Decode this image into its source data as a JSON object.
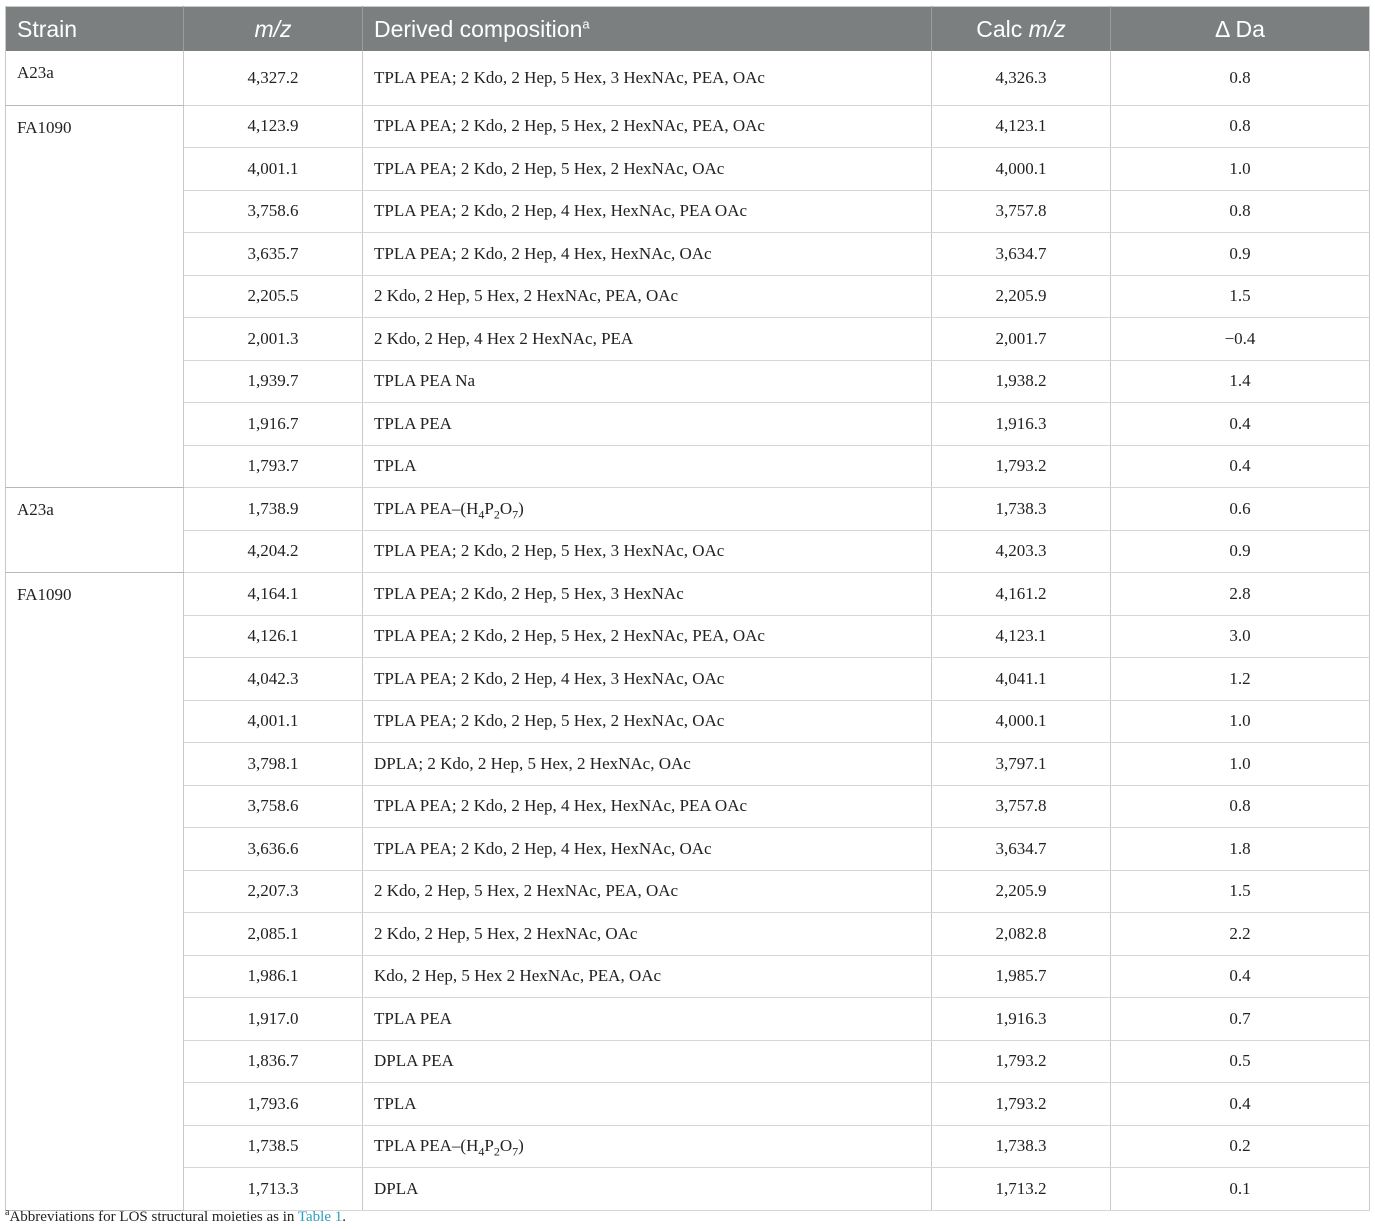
{
  "table": {
    "headers": {
      "strain": "Strain",
      "mz": "m/z",
      "composition": "Derived composition",
      "composition_note_marker": "a",
      "calc_prefix": "Calc ",
      "calc_italic": "m/z",
      "delta": "Δ Da"
    },
    "groups": [
      {
        "strain": "A23a",
        "rows": [
          {
            "mz": "4,327.2",
            "comp": "TPLA PEA; 2 Kdo, 2 Hep, 5 Hex, 3 HexNAc, PEA, OAc",
            "calc": "4,326.3",
            "delta": "0.8"
          }
        ]
      },
      {
        "strain": "FA1090",
        "rows": [
          {
            "mz": "4,123.9",
            "comp": "TPLA PEA; 2 Kdo, 2 Hep, 5 Hex, 2 HexNAc, PEA, OAc",
            "calc": "4,123.1",
            "delta": "0.8"
          },
          {
            "mz": "4,001.1",
            "comp": "TPLA PEA; 2 Kdo, 2 Hep, 5 Hex, 2 HexNAc, OAc",
            "calc": "4,000.1",
            "delta": "1.0"
          },
          {
            "mz": "3,758.6",
            "comp": "TPLA PEA; 2 Kdo, 2 Hep, 4 Hex, HexNAc, PEA OAc",
            "calc": "3,757.8",
            "delta": "0.8"
          },
          {
            "mz": "3,635.7",
            "comp": "TPLA PEA; 2 Kdo, 2 Hep, 4 Hex, HexNAc, OAc",
            "calc": "3,634.7",
            "delta": "0.9"
          },
          {
            "mz": "2,205.5",
            "comp": "2 Kdo, 2 Hep, 5 Hex, 2 HexNAc, PEA, OAc",
            "calc": "2,205.9",
            "delta": "1.5"
          },
          {
            "mz": "2,001.3",
            "comp": "2 Kdo, 2 Hep, 4 Hex 2 HexNAc, PEA",
            "calc": "2,001.7",
            "delta": "−0.4"
          },
          {
            "mz": "1,939.7",
            "comp": "TPLA PEA Na",
            "calc": "1,938.2",
            "delta": "1.4"
          },
          {
            "mz": "1,916.7",
            "comp": "TPLA PEA",
            "calc": "1,916.3",
            "delta": "0.4"
          },
          {
            "mz": "1,793.7",
            "comp": "TPLA",
            "calc": "1,793.2",
            "delta": "0.4"
          }
        ]
      },
      {
        "strain": "A23a",
        "rows": [
          {
            "mz": "1,738.9",
            "comp": "TPLA PEA–(H4P2O7)",
            "calc": "1,738.3",
            "delta": "0.6"
          },
          {
            "mz": "4,204.2",
            "comp": "TPLA PEA; 2 Kdo, 2 Hep, 5 Hex, 3 HexNAc, OAc",
            "calc": "4,203.3",
            "delta": "0.9"
          }
        ]
      },
      {
        "strain": "FA1090",
        "rows": [
          {
            "mz": "4,164.1",
            "comp": "TPLA PEA; 2 Kdo, 2 Hep, 5 Hex, 3 HexNAc",
            "calc": "4,161.2",
            "delta": "2.8"
          },
          {
            "mz": "4,126.1",
            "comp": "TPLA PEA; 2 Kdo, 2 Hep, 5 Hex, 2 HexNAc, PEA, OAc",
            "calc": "4,123.1",
            "delta": "3.0"
          },
          {
            "mz": "4,042.3",
            "comp": "TPLA PEA; 2 Kdo, 2 Hep, 4 Hex, 3 HexNAc, OAc",
            "calc": "4,041.1",
            "delta": "1.2"
          },
          {
            "mz": "4,001.1",
            "comp": "TPLA PEA; 2 Kdo, 2 Hep, 5 Hex, 2 HexNAc, OAc",
            "calc": "4,000.1",
            "delta": "1.0"
          },
          {
            "mz": "3,798.1",
            "comp": "DPLA; 2 Kdo, 2 Hep, 5 Hex, 2 HexNAc, OAc",
            "calc": "3,797.1",
            "delta": "1.0"
          },
          {
            "mz": "3,758.6",
            "comp": "TPLA PEA; 2 Kdo, 2 Hep, 4 Hex, HexNAc, PEA OAc",
            "calc": "3,757.8",
            "delta": "0.8"
          },
          {
            "mz": "3,636.6",
            "comp": "TPLA PEA; 2 Kdo, 2 Hep, 4 Hex, HexNAc, OAc",
            "calc": "3,634.7",
            "delta": "1.8"
          },
          {
            "mz": "2,207.3",
            "comp": "2 Kdo, 2 Hep, 5 Hex, 2 HexNAc, PEA, OAc",
            "calc": "2,205.9",
            "delta": "1.5"
          },
          {
            "mz": "2,085.1",
            "comp": "2 Kdo, 2 Hep, 5 Hex, 2 HexNAc, OAc",
            "calc": "2,082.8",
            "delta": "2.2"
          },
          {
            "mz": "1,986.1",
            "comp": "Kdo, 2 Hep, 5 Hex 2 HexNAc, PEA, OAc",
            "calc": "1,985.7",
            "delta": "0.4"
          },
          {
            "mz": "1,917.0",
            "comp": "TPLA PEA",
            "calc": "1,916.3",
            "delta": "0.7"
          },
          {
            "mz": "1,836.7",
            "comp": "DPLA PEA",
            "calc": "1,793.2",
            "delta": "0.5"
          },
          {
            "mz": "1,793.6",
            "comp": "TPLA",
            "calc": "1,793.2",
            "delta": "0.4"
          },
          {
            "mz": "1,738.5",
            "comp": "TPLA PEA–(H4P2O7)",
            "calc": "1,738.3",
            "delta": "0.2"
          },
          {
            "mz": "1,713.3",
            "comp": "DPLA",
            "calc": "1,713.2",
            "delta": "0.1"
          }
        ]
      }
    ]
  },
  "footnote": {
    "marker": "a",
    "text": "Abbreviations for LOS structural moieties as in ",
    "link": "Table 1",
    "end": "."
  },
  "colors": {
    "header_bg": "#7b7f80",
    "header_text": "#ffffff",
    "link": "#2a9fbf"
  }
}
